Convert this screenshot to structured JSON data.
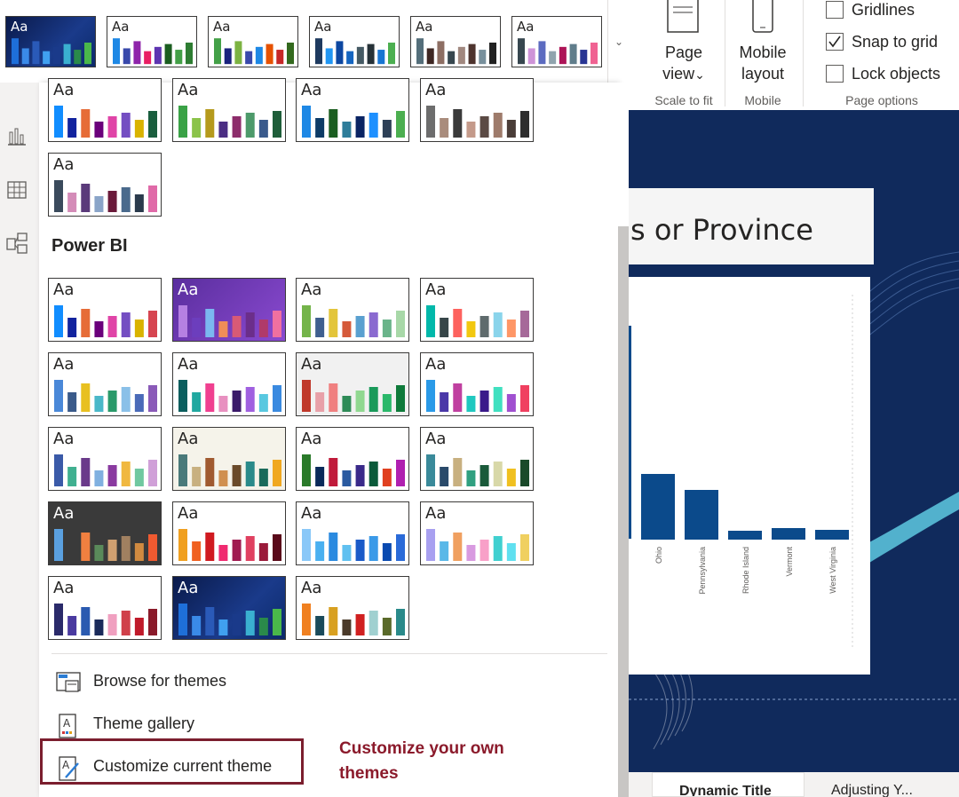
{
  "ribbon": {
    "page_view_line1": "Page",
    "page_view_line2": "view",
    "page_view_chevron": "⌄",
    "mobile_line1": "Mobile",
    "mobile_line2": "layout",
    "group_scale": "Scale to fit",
    "group_mobile": "Mobile",
    "group_page_options": "Page options",
    "gridlines_label": "Gridlines",
    "gridlines_checked": false,
    "snap_label": "Snap to grid",
    "snap_checked": true,
    "lock_label": "Lock objects",
    "lock_checked": false,
    "expand_icon": "⌄"
  },
  "canvas": {
    "title_fragment": "s or Province",
    "bottom_tab_1": "Dynamic Title",
    "bottom_tab_2": "Adjusting Y..."
  },
  "panel": {
    "aa_text": "Aa",
    "section_title": "Power BI",
    "menu": [
      {
        "label": "Browse for themes",
        "icon": "browse-themes-icon"
      },
      {
        "label": "Theme gallery",
        "icon": "theme-gallery-icon"
      },
      {
        "label": "Customize current theme",
        "icon": "customize-theme-icon"
      }
    ]
  },
  "annotation": {
    "line1": "Customize your own",
    "line2": "themes"
  },
  "chart_data": {
    "type": "bar",
    "categories": [
      "Ohio",
      "Pennsylvania",
      "Rhode Island",
      "Vermont",
      "West Virginia"
    ],
    "values": [
      74,
      56,
      10,
      13,
      11
    ],
    "bar_color": "#0b4a8b"
  },
  "colors": {
    "accent_border": "#7b1e2e",
    "annotation": "#8b1a2b",
    "canvas_bg": "#102a5c"
  }
}
